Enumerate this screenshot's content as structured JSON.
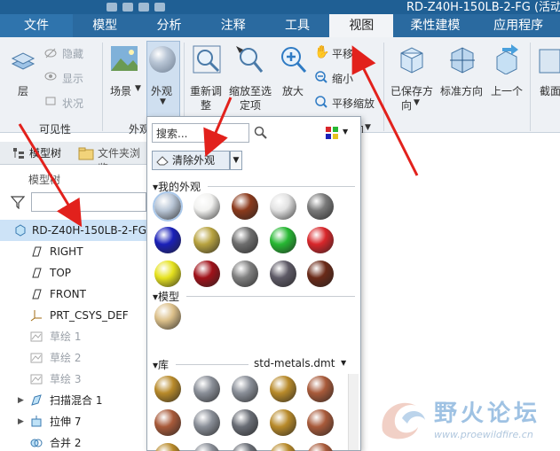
{
  "window": {
    "title": "RD-Z40H-150LB-2-FG (活动"
  },
  "tabs": [
    "文件",
    "模型",
    "分析",
    "注释",
    "工具",
    "视图",
    "柔性建模",
    "应用程序"
  ],
  "ribbon": {
    "layers": "层",
    "hide": "隐藏",
    "show": "显示",
    "status": "状况",
    "visibility_group": "可见性",
    "scene": "场景",
    "appearance": "外观",
    "appearance_group_fragment": "外观",
    "refit_line1": "重新调",
    "refit_line2": "整",
    "zoom_sel_line1": "缩放至选",
    "zoom_sel_line2": "定项",
    "zoom_in": "放大",
    "pan": "平移",
    "zoom_out": "缩小",
    "pan_zoom": "平移缩放",
    "saved_line1": "已保存方",
    "saved_line2": "向",
    "std_orient": "标准方向",
    "prev": "上一个",
    "section_cut": "截面",
    "orient_group_fragment": "向"
  },
  "left_tabs": {
    "model_tree": "模型树",
    "folder": "文件夹浏览"
  },
  "tree": {
    "header": "模型树",
    "items": [
      {
        "label": "RD-Z40H-150LB-2-FG.",
        "icon": "part-icon",
        "gray": false
      },
      {
        "label": "RIGHT",
        "icon": "datum-plane-icon",
        "gray": false
      },
      {
        "label": "TOP",
        "icon": "datum-plane-icon",
        "gray": false
      },
      {
        "label": "FRONT",
        "icon": "datum-plane-icon",
        "gray": false
      },
      {
        "label": "PRT_CSYS_DEF",
        "icon": "csys-icon",
        "gray": false
      },
      {
        "label": "草绘 1",
        "icon": "sketch-icon",
        "gray": true
      },
      {
        "label": "草绘 2",
        "icon": "sketch-icon",
        "gray": true
      },
      {
        "label": "草绘 3",
        "icon": "sketch-icon",
        "gray": true
      },
      {
        "label": "扫描混合 1",
        "icon": "sweep-blend-icon",
        "gray": false
      },
      {
        "label": "拉伸 7",
        "icon": "extrude-icon",
        "gray": false
      },
      {
        "label": "合并 2",
        "icon": "merge-icon",
        "gray": false
      }
    ]
  },
  "dropdown": {
    "search_placeholder": "搜索...",
    "clear_label": "清除外观",
    "my_appearances": "我的外观",
    "model": "模型",
    "library": "库",
    "library_file": "std-metals.dmt"
  },
  "swatches": {
    "my": [
      "#b9c6d6",
      "#f2f2f0",
      "#8b3a1c",
      "#e2e2e2",
      "#7a7a7a",
      "#1a20b8",
      "#b8a340",
      "#6e6e6e",
      "#27b833",
      "#d8262a",
      "#e6e21f",
      "#a0121a",
      "#808080",
      "#5e5a66",
      "#6a2a18"
    ],
    "model": [
      "#dcc08a"
    ],
    "library": [
      "#b88a2a",
      "#8a8f98",
      "#8a8f98",
      "#b88a2a",
      "#a85a3a",
      "#a85a3a",
      "#8a8f98",
      "#6a6e76",
      "#b88a2a",
      "#a85a3a",
      "#b88a2a",
      "#8a8f98",
      "#6a6e76",
      "#b88a2a",
      "#a85a3a"
    ]
  },
  "watermark": {
    "title": "野火论坛",
    "url": "www.proewildfire.cn"
  }
}
